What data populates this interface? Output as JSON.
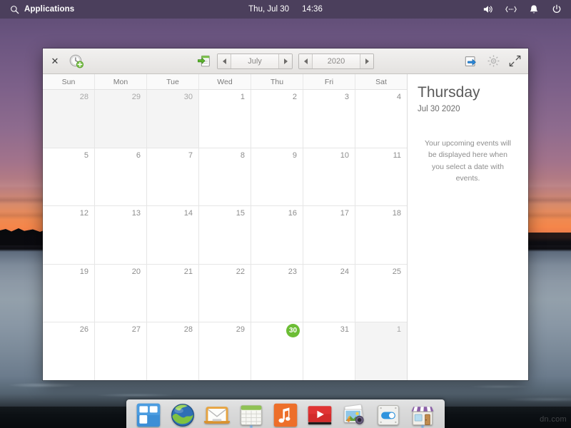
{
  "top_panel": {
    "applications_label": "Applications",
    "search_icon": "search-icon",
    "clock_date": "Thu, Jul 30",
    "clock_time": "14:36",
    "tray": [
      {
        "icon": "volume-icon",
        "name": "volume"
      },
      {
        "icon": "network-icon",
        "name": "network"
      },
      {
        "icon": "bell-icon",
        "name": "notifications"
      },
      {
        "icon": "power-icon",
        "name": "power"
      }
    ],
    "background_color": "#4b3f5c"
  },
  "calendar_window": {
    "toolbar": {
      "close_label": "✕",
      "add_event_icon": "clock-add-icon",
      "import_icon": "import-document-icon",
      "export_icon": "export-arrow-icon",
      "settings_icon": "gear-icon",
      "fullscreen_icon": "fullscreen-arrows-icon",
      "month_value": "July",
      "year_value": "2020",
      "prev_arrow": "chevron-left-icon",
      "next_arrow": "chevron-right-icon"
    },
    "weekdays": [
      "Sun",
      "Mon",
      "Tue",
      "Wed",
      "Thu",
      "Fri",
      "Sat"
    ],
    "weeks": [
      [
        {
          "n": "28",
          "adjacent": true
        },
        {
          "n": "29",
          "adjacent": true
        },
        {
          "n": "30",
          "adjacent": true
        },
        {
          "n": "1"
        },
        {
          "n": "2"
        },
        {
          "n": "3"
        },
        {
          "n": "4"
        }
      ],
      [
        {
          "n": "5"
        },
        {
          "n": "6"
        },
        {
          "n": "7"
        },
        {
          "n": "8"
        },
        {
          "n": "9"
        },
        {
          "n": "10"
        },
        {
          "n": "11"
        }
      ],
      [
        {
          "n": "12"
        },
        {
          "n": "13"
        },
        {
          "n": "14"
        },
        {
          "n": "15"
        },
        {
          "n": "16"
        },
        {
          "n": "17"
        },
        {
          "n": "18"
        }
      ],
      [
        {
          "n": "19"
        },
        {
          "n": "20"
        },
        {
          "n": "21"
        },
        {
          "n": "22"
        },
        {
          "n": "23"
        },
        {
          "n": "24"
        },
        {
          "n": "25"
        }
      ],
      [
        {
          "n": "26"
        },
        {
          "n": "27"
        },
        {
          "n": "28"
        },
        {
          "n": "29"
        },
        {
          "n": "30",
          "selected": true
        },
        {
          "n": "31"
        },
        {
          "n": "1",
          "adjacent": true
        }
      ]
    ],
    "sidebar": {
      "weekday_title": "Thursday",
      "date_line": "Jul 30 2020",
      "empty_message": "Your upcoming events will be displayed here when you select a date with events."
    },
    "selected_day_color": "#6cbd35"
  },
  "dock": {
    "items": [
      {
        "name": "dock-item-applications",
        "icon": "app-grid-icon",
        "running": false
      },
      {
        "name": "dock-item-web-browser",
        "icon": "globe-icon",
        "running": false
      },
      {
        "name": "dock-item-mail",
        "icon": "envelope-icon",
        "running": false
      },
      {
        "name": "dock-item-calendar",
        "icon": "calendar-icon",
        "running": true
      },
      {
        "name": "dock-item-music",
        "icon": "music-note-icon",
        "running": false
      },
      {
        "name": "dock-item-video",
        "icon": "play-button-icon",
        "running": false
      },
      {
        "name": "dock-item-photos",
        "icon": "photos-icon",
        "running": false
      },
      {
        "name": "dock-item-settings",
        "icon": "toggle-switch-icon",
        "running": false
      },
      {
        "name": "dock-item-software-store",
        "icon": "storefront-icon",
        "running": true
      }
    ]
  },
  "watermark": {
    "text": "dn.com"
  }
}
